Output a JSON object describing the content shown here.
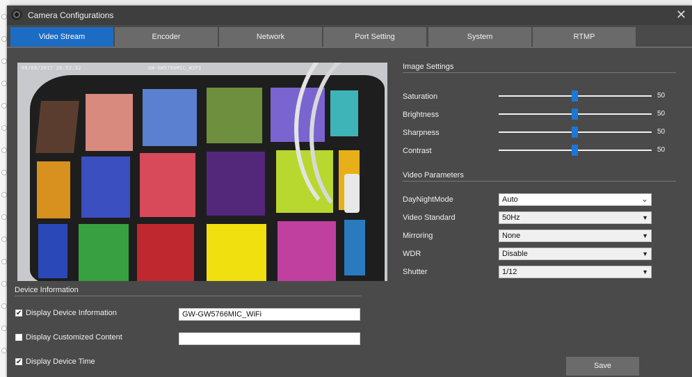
{
  "window": {
    "title": "Camera Configurations",
    "close_glyph": "✕",
    "app_icon": "camera-lens-icon"
  },
  "tabs": [
    {
      "label": "Video Stream",
      "active": true
    },
    {
      "label": "Encoder",
      "active": false
    },
    {
      "label": "Network",
      "active": false
    },
    {
      "label": "Port Setting",
      "active": false
    },
    {
      "label": "System",
      "active": false
    },
    {
      "label": "RTMP",
      "active": false
    }
  ],
  "preview": {
    "osd_time": "08/08/2017 16:52:32",
    "osd_name": "GW-GW5766MIC_WIFI"
  },
  "image_settings": {
    "title": "Image Settings",
    "items": [
      {
        "label": "Saturation",
        "value": "50"
      },
      {
        "label": "Brightness",
        "value": "50"
      },
      {
        "label": "Sharpness",
        "value": "50"
      },
      {
        "label": "Contrast",
        "value": "50"
      }
    ]
  },
  "video_parameters": {
    "title": "Video Parameters",
    "items": [
      {
        "label": "DayNightMode",
        "value": "Auto"
      },
      {
        "label": "Video Standard",
        "value": "50Hz"
      },
      {
        "label": "Mirroring",
        "value": "None"
      },
      {
        "label": "WDR",
        "value": "Disable"
      },
      {
        "label": "Shutter",
        "value": "1/12"
      }
    ]
  },
  "device_info": {
    "title": "Device Information",
    "rows": [
      {
        "label": "Display Device Information",
        "checked": true,
        "value": "GW-GW5766MIC_WiFi"
      },
      {
        "label": "Display Customized Content",
        "checked": false,
        "value": ""
      },
      {
        "label": "Display Device Time",
        "checked": true
      }
    ]
  },
  "save_label": "Save",
  "colors": {
    "accent": "#1c6cc4",
    "background": "#4a4a4a",
    "tab": "#6a6a6a",
    "slider_thumb": "#1a78d8"
  }
}
